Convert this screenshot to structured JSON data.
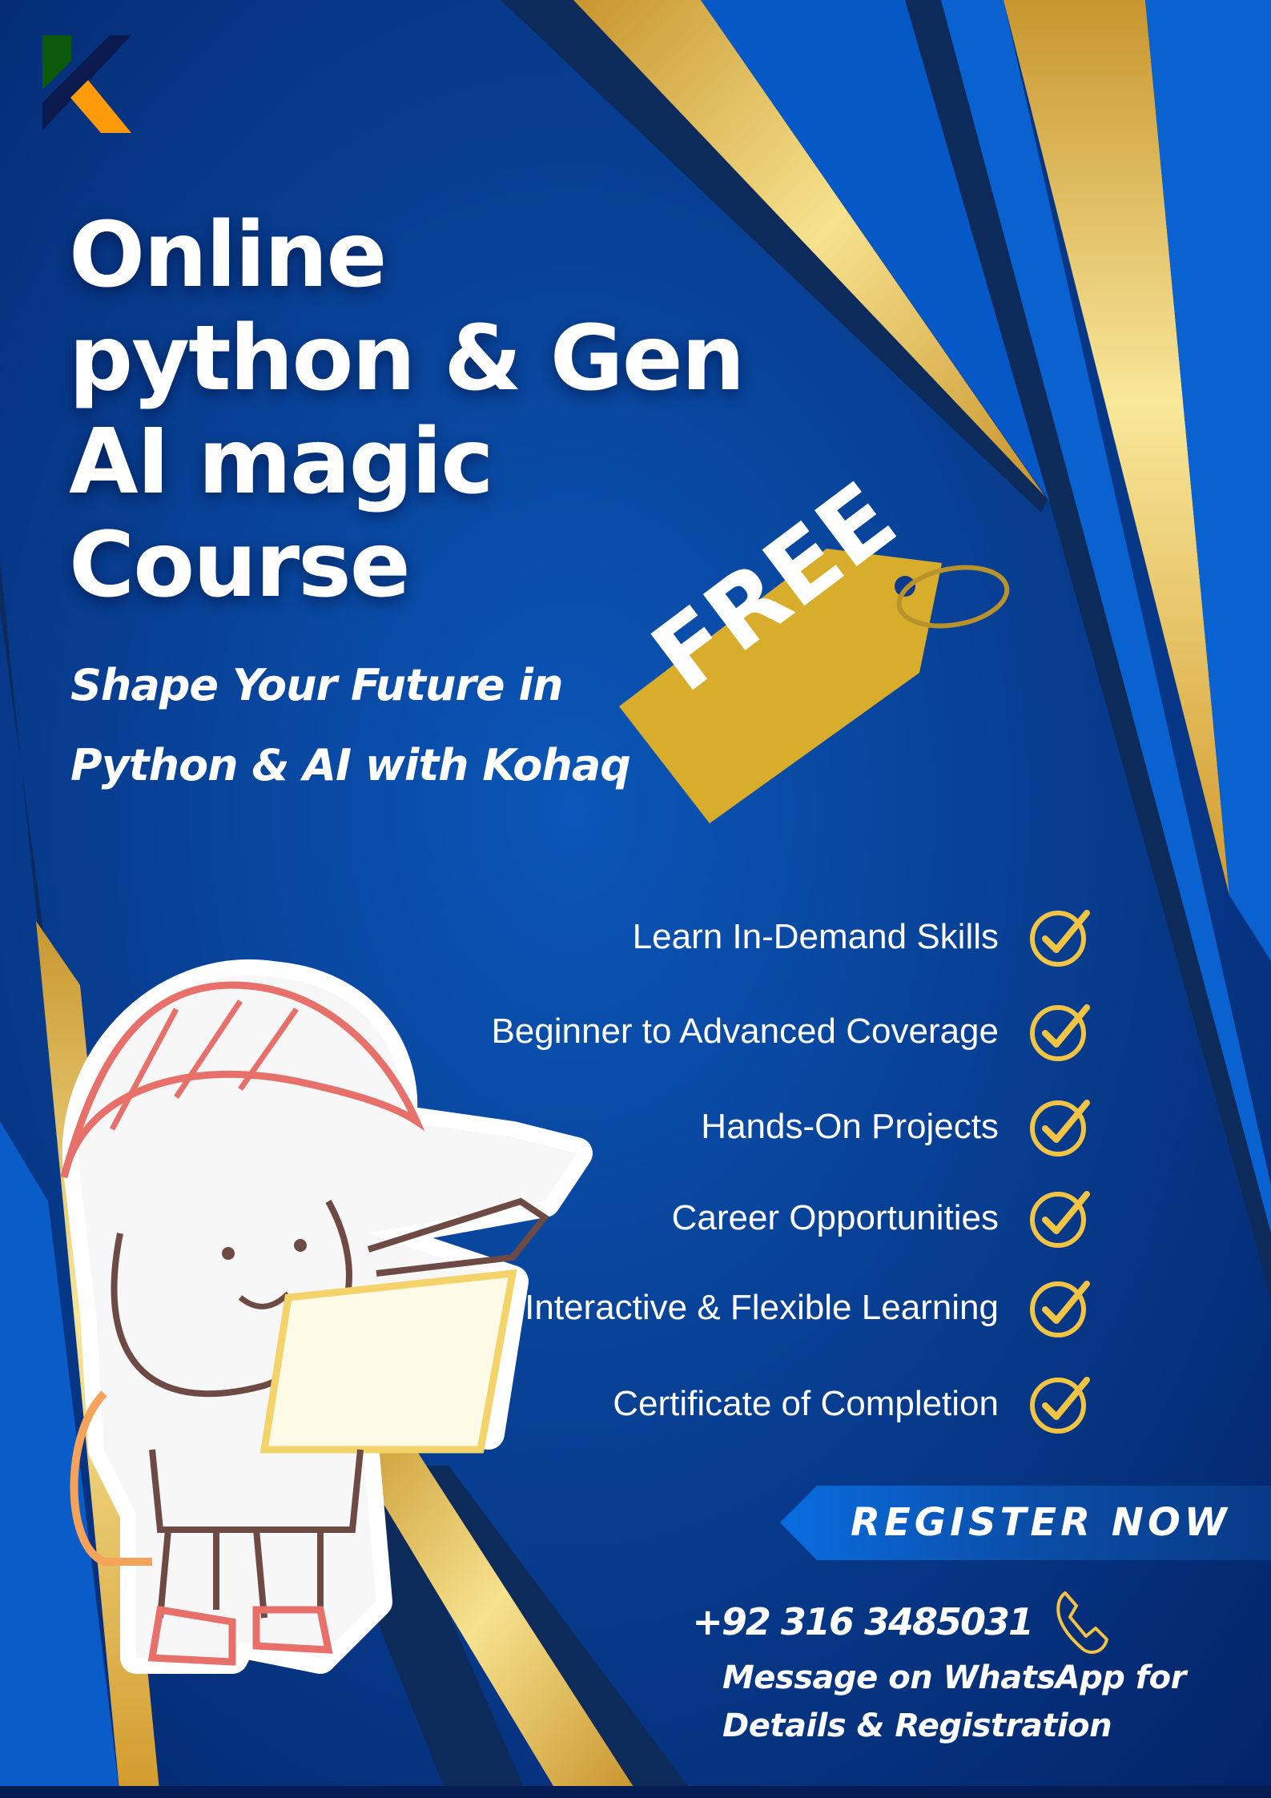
{
  "brand": {
    "logo_letter": "K",
    "colors": {
      "green": "#0b5a0b",
      "navy": "#0b1a4e",
      "orange": "#ff9a0a"
    }
  },
  "title": {
    "lines": [
      "Online",
      "python & Gen",
      "AI magic",
      "Course"
    ]
  },
  "subtitle": {
    "lines": [
      "Shape Your Future in",
      "Python & AI with Kohaq"
    ]
  },
  "price_tag": {
    "label": "FREE",
    "color": "#d9ad2c"
  },
  "features": [
    {
      "label": "Learn In-Demand Skills",
      "icon": "check-circle-icon"
    },
    {
      "label": "Beginner to Advanced Coverage",
      "icon": "check-circle-icon"
    },
    {
      "label": "Hands-On Projects",
      "icon": "check-circle-icon"
    },
    {
      "label": "Career Opportunities",
      "icon": "check-circle-icon"
    },
    {
      "label": "Interactive & Flexible Learning",
      "icon": "check-circle-icon"
    },
    {
      "label": "Certificate of Completion",
      "icon": "check-circle-icon"
    }
  ],
  "cta": {
    "label": "REGISTER NOW"
  },
  "contact": {
    "phone": "+92 316 3485031",
    "phone_icon": "phone-icon",
    "message_lines": [
      "Message on WhatsApp for",
      "Details & Registration"
    ]
  },
  "colors": {
    "background": "#0a3a8c",
    "gold": "#e8c15a",
    "accent_check": "#f2c443"
  }
}
